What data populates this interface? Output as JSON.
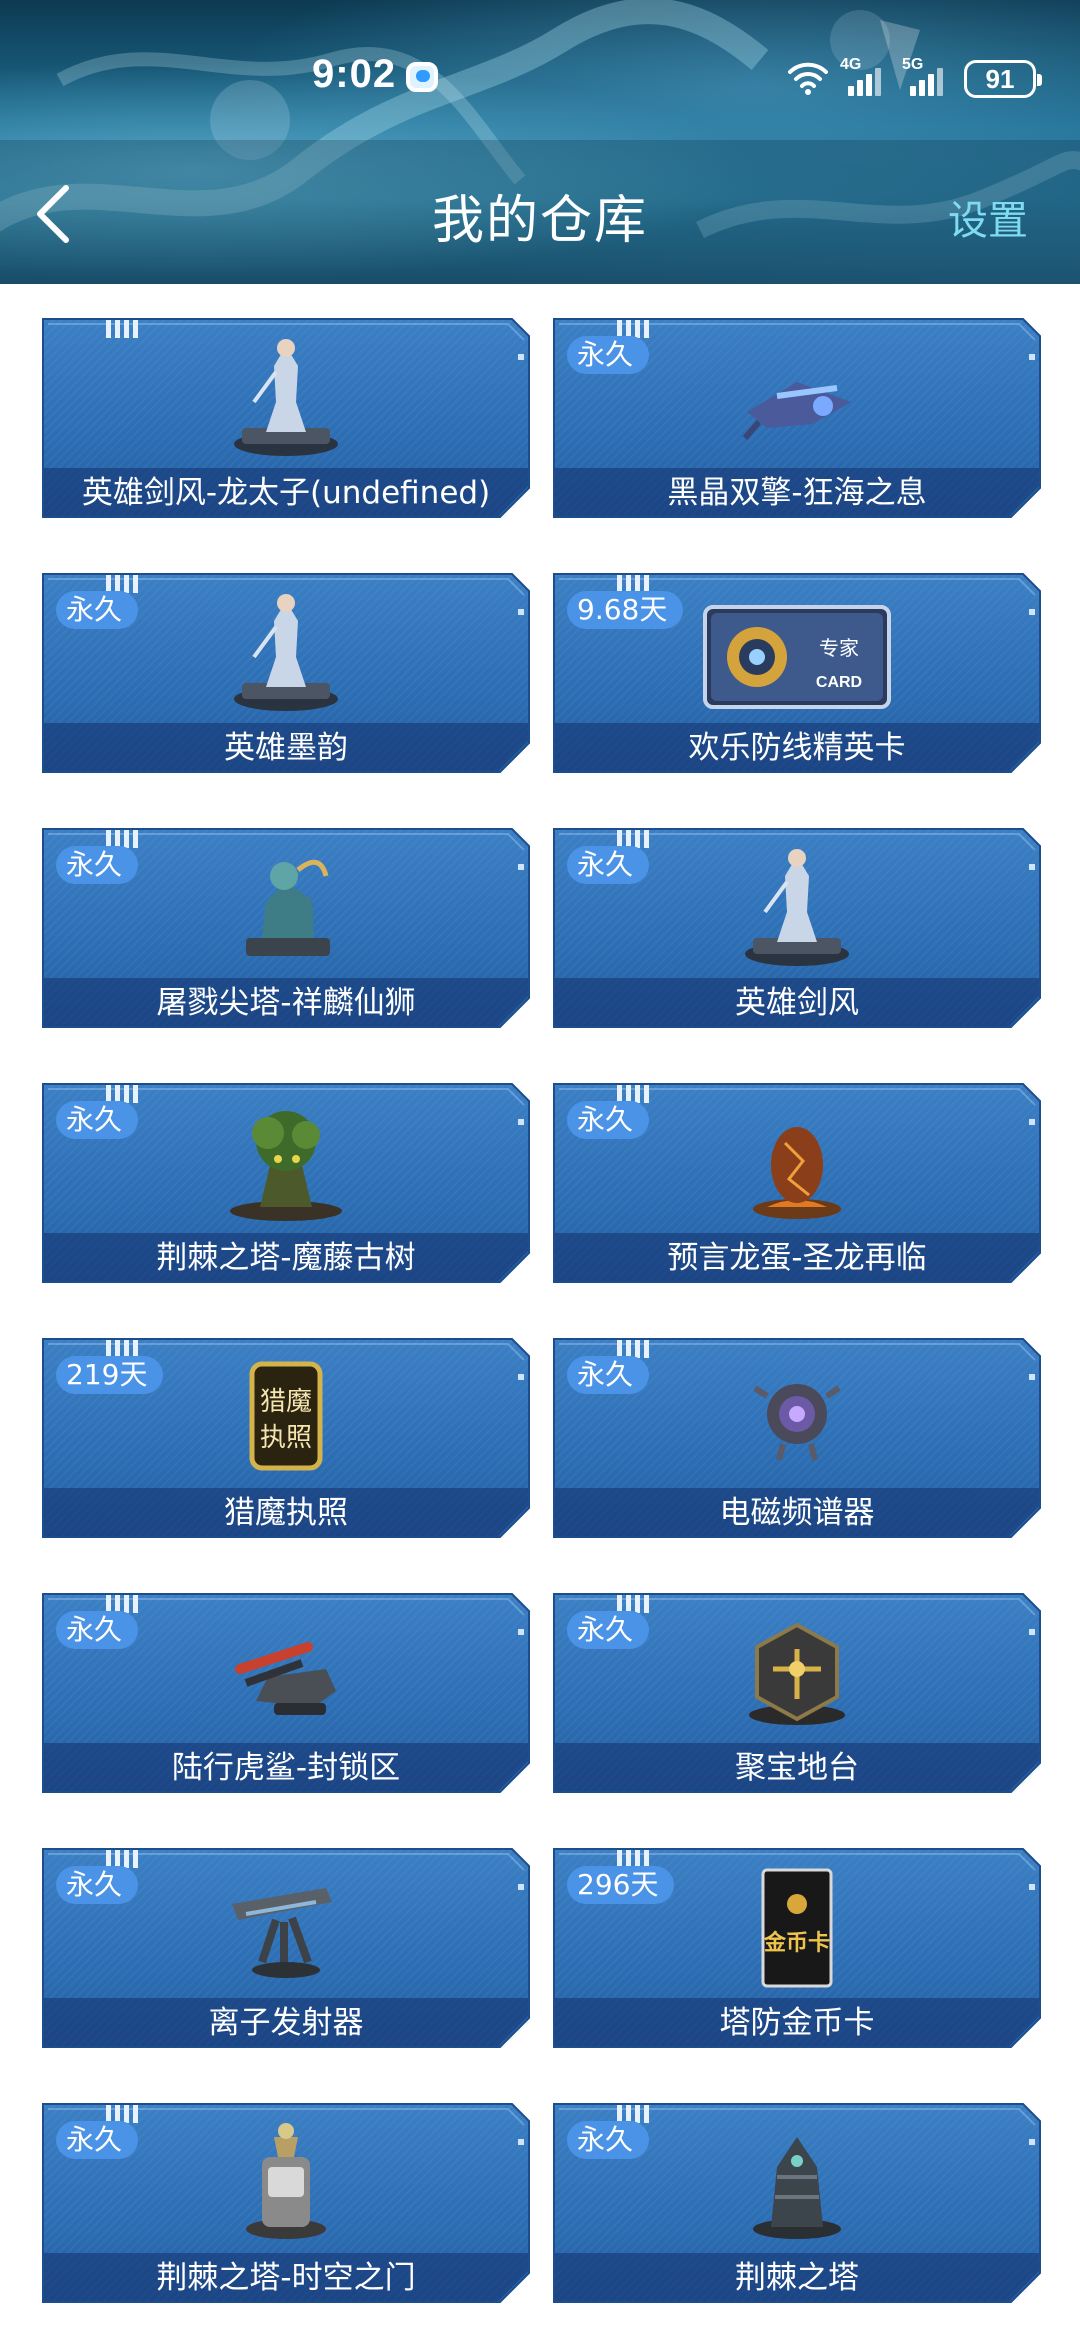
{
  "status_bar": {
    "time": "9:02",
    "net_4g": "4G",
    "net_5g": "5G",
    "battery": "91"
  },
  "header": {
    "title": "我的仓库",
    "settings_label": "设置"
  },
  "items": [
    {
      "name": "英雄剑风-龙太子(undefined)",
      "badge": "",
      "icon": "hero-figure-icon"
    },
    {
      "name": "黑晶双擎-狂海之息",
      "badge": "永久",
      "icon": "aircraft-icon"
    },
    {
      "name": "英雄墨韵",
      "badge": "永久",
      "icon": "hero-figure-icon"
    },
    {
      "name": "欢乐防线精英卡",
      "badge": "9.68天",
      "icon": "expert-card-icon",
      "card_line1": "专家",
      "card_line2": "CARD"
    },
    {
      "name": "屠戮尖塔-祥麟仙狮",
      "badge": "永久",
      "icon": "lion-tower-icon"
    },
    {
      "name": "英雄剑风",
      "badge": "永久",
      "icon": "hero-figure-icon"
    },
    {
      "name": "荆棘之塔-魔藤古树",
      "badge": "永久",
      "icon": "tree-tower-icon"
    },
    {
      "name": "预言龙蛋-圣龙再临",
      "badge": "永久",
      "icon": "dragon-egg-icon"
    },
    {
      "name": "猎魔执照",
      "badge": "219天",
      "icon": "license-icon",
      "art_text": "猎魔执照"
    },
    {
      "name": "电磁频谱器",
      "badge": "永久",
      "icon": "spectrum-device-icon"
    },
    {
      "name": "陆行虎鲨-封锁区",
      "badge": "永久",
      "icon": "tank-icon"
    },
    {
      "name": "聚宝地台",
      "badge": "永久",
      "icon": "treasure-platform-icon"
    },
    {
      "name": "离子发射器",
      "badge": "永久",
      "icon": "ion-launcher-icon"
    },
    {
      "name": "塔防金币卡",
      "badge": "296天",
      "icon": "gold-coin-card-icon",
      "art_text": "金币卡"
    },
    {
      "name": "荆棘之塔-时空之门",
      "badge": "永久",
      "icon": "time-gate-tower-icon"
    },
    {
      "name": "荆棘之塔",
      "badge": "永久",
      "icon": "thorn-tower-icon"
    }
  ],
  "colors": {
    "card": "#2d6fb5",
    "badge": "#4a93e6",
    "settings": "#7fdcf0"
  }
}
